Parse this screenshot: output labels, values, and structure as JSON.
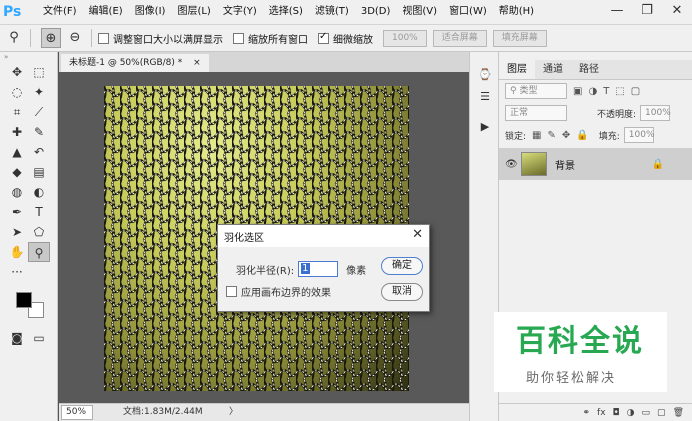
{
  "app": {
    "logo": "Ps"
  },
  "menu": [
    "文件(F)",
    "编辑(E)",
    "图像(I)",
    "图层(L)",
    "文字(Y)",
    "选择(S)",
    "滤镜(T)",
    "3D(D)",
    "视图(V)",
    "窗口(W)",
    "帮助(H)"
  ],
  "window_controls": {
    "minimize": "—",
    "restore": "❐",
    "close": "✕"
  },
  "options_bar": {
    "resize_windows_label": "调整窗口大小以满屏显示",
    "resize_windows_checked": false,
    "zoom_all_label": "缩放所有窗口",
    "zoom_all_checked": false,
    "scrubby_zoom_label": "细微缩放",
    "scrubby_zoom_checked": true,
    "zoom_percent_btn": "100%",
    "fit_screen_btn": "适合屏幕",
    "fill_screen_btn": "填充屏幕"
  },
  "document": {
    "tab_title": "未标题-1 @ 50%(RGB/8) *",
    "zoom": "50%",
    "doc_info": "文档:1.83M/2.44M",
    "status_arrow": "〉"
  },
  "layers_panel": {
    "tabs": [
      "图层",
      "通道",
      "路径"
    ],
    "active_tab": 0,
    "filter_label": "类型",
    "blend_mode": "正常",
    "opacity_label": "不透明度:",
    "opacity_value": "100%",
    "lock_label": "锁定:",
    "fill_label": "填充:",
    "fill_value": "100%",
    "layer_name": "背景"
  },
  "dialog": {
    "title": "羽化选区",
    "radius_label": "羽化半径(R):",
    "radius_value": "1",
    "unit": "像素",
    "canvas_edge_label": "应用画布边界的效果",
    "canvas_edge_checked": false,
    "ok": "确定",
    "cancel": "取消"
  },
  "watermark": {
    "title": "百科全说",
    "subtitle": "助你轻松解决"
  },
  "colors": {
    "accent": "#31a8ff",
    "watermark_green": "#27a851",
    "canvas_yellow": "#c7cb5c"
  }
}
